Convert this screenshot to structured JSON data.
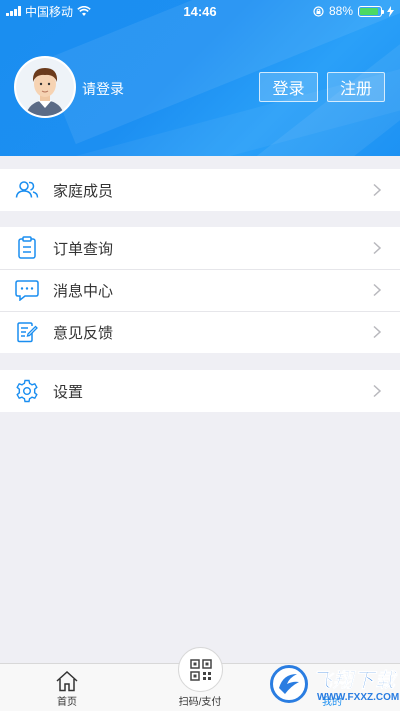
{
  "status_bar": {
    "carrier": "中国移动",
    "time": "14:46",
    "battery_percent": "88%",
    "battery_level": 0.88,
    "icons": [
      "signal-icon",
      "wifi-icon",
      "orientation-lock-icon",
      "battery-icon",
      "charging-icon"
    ]
  },
  "header": {
    "login_prompt": "请登录",
    "login_button": "登录",
    "register_button": "注册",
    "avatar": "default-avatar"
  },
  "menu": {
    "family_members": "家庭成员",
    "order_query": "订单查询",
    "message_center": "消息中心",
    "feedback": "意见反馈",
    "settings": "设置"
  },
  "tabbar": {
    "home": "首页",
    "scan_pay": "扫码/支付",
    "mine": "我的"
  },
  "watermark": {
    "title": "飞翔下载",
    "url": "WWW.FXXZ.COM"
  },
  "colors": {
    "accent": "#1a8ef0",
    "icon": "#1a8ef0",
    "background": "#efeff4"
  }
}
